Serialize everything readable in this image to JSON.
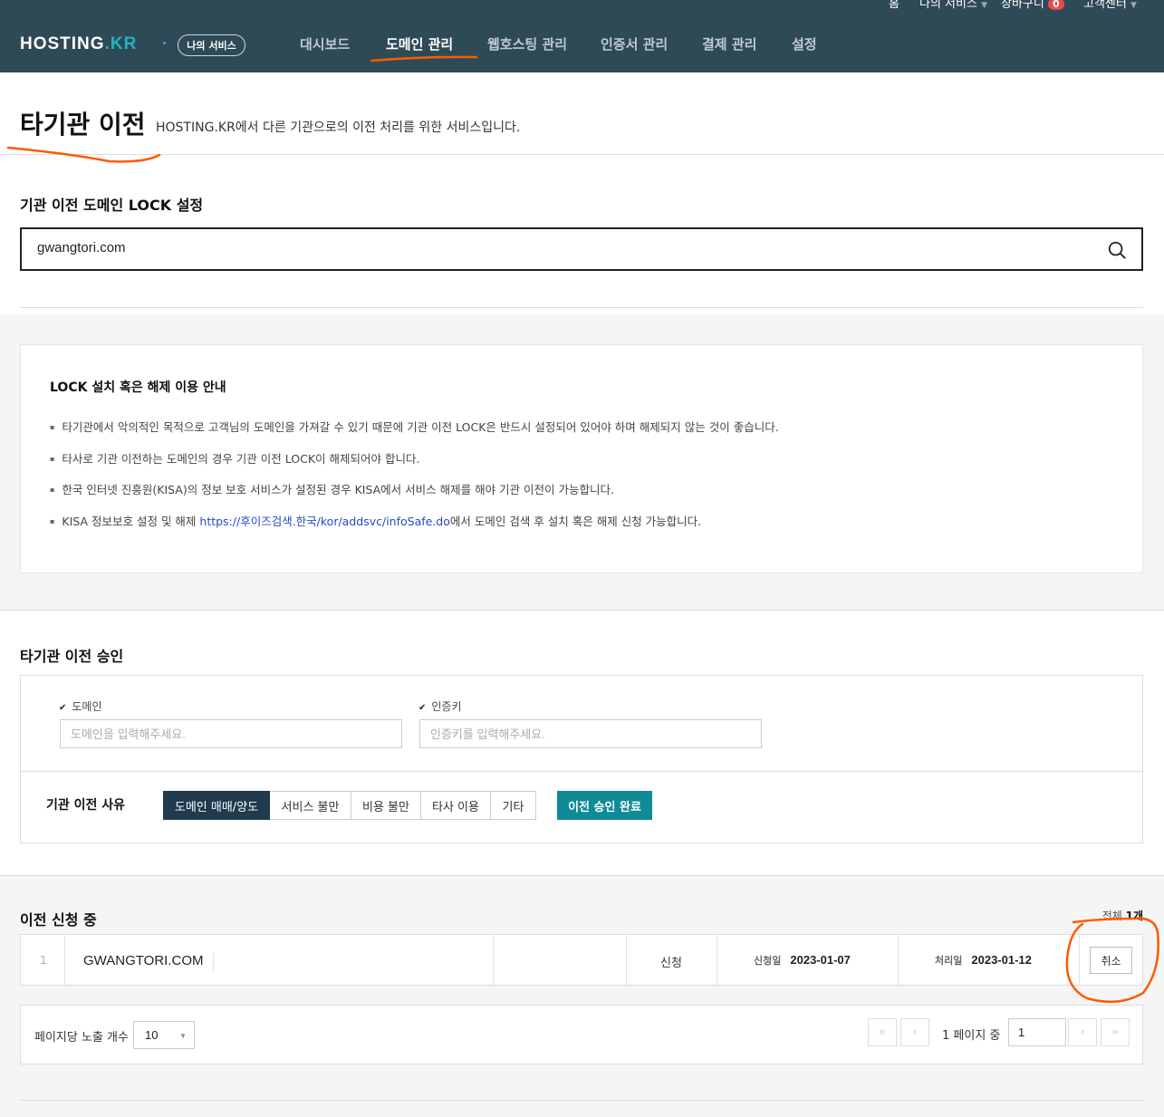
{
  "header": {
    "logo": "HOSTING",
    "logo_suffix": ".KR",
    "my_service_pill": "나의 서비스",
    "nav": [
      "대시보드",
      "도메인 관리",
      "웹호스팅 관리",
      "인증서 관리",
      "결제 관리",
      "설정"
    ],
    "active_nav": "도메인 관리",
    "util": {
      "home": "홈",
      "my_service": "나의 서비스",
      "cart": "장바구니",
      "cart_count": "0",
      "support": "고객센터"
    }
  },
  "page": {
    "title": "타기관 이전",
    "description": "HOSTING.KR에서 다른 기관으로의 이전 처리를 위한 서비스입니다."
  },
  "lock": {
    "section_title": "기관 이전 도메인 LOCK 설정",
    "search_value": "gwangtori.com"
  },
  "info": {
    "title": "LOCK 설치 혹은 해제 이용 안내",
    "items": [
      "타기관에서 악의적인 목적으로 고객님의 도메인을 가져갈 수 있기 때문에 기관 이전 LOCK은 반드시 설정되어 있어야 하며 해제되지 않는 것이 좋습니다.",
      "타사로 기관 이전하는 도메인의 경우 기관 이전 LOCK이 해제되어야 합니다.",
      "한국 인터넷 진흥원(KISA)의 정보 보호 서비스가 설정된 경우 KISA에서 서비스 해제를 해야 기관 이전이 가능합니다."
    ],
    "last_prefix": "KISA 정보보호 설정 및 해제 ",
    "last_link": "https://후이즈검색.한국/kor/addsvc/infoSafe.do",
    "last_suffix": "에서 도메인 검색 후 설치 혹은 해제 신청 가능합니다."
  },
  "approve": {
    "section_title": "타기관 이전 승인",
    "domain_label": "도메인",
    "domain_placeholder": "도메인을 입력해주세요.",
    "authkey_label": "인증키",
    "authkey_placeholder": "인증키를 입력해주세요.",
    "reason_label": "기관 이전 사유",
    "reasons": [
      "도메인 매매/양도",
      "서비스 불만",
      "비용 불만",
      "타사 이용",
      "기타"
    ],
    "active_reason": "도메인 매매/양도",
    "submit_label": "이전 승인 완료"
  },
  "pending": {
    "section_title": "이전 신청 중",
    "total_prefix": "전체 ",
    "total_count": "1개",
    "rows": [
      {
        "num": "1",
        "domain": "GWANGTORI.COM",
        "status": "신청",
        "apply_label": "신청일",
        "apply_date": "2023-01-07",
        "process_label": "처리일",
        "process_date": "2023-01-12",
        "cancel_label": "취소"
      }
    ]
  },
  "pager": {
    "per_page_label": "페이지당 노출 개수",
    "per_page_value": "10",
    "page_info": "1 페이지 중",
    "current_page": "1"
  },
  "colors": {
    "header_bg": "#2e4a57",
    "accent_teal": "#0f8b98",
    "active_segment": "#1f3b4d",
    "annotation": "#ff5a00"
  }
}
